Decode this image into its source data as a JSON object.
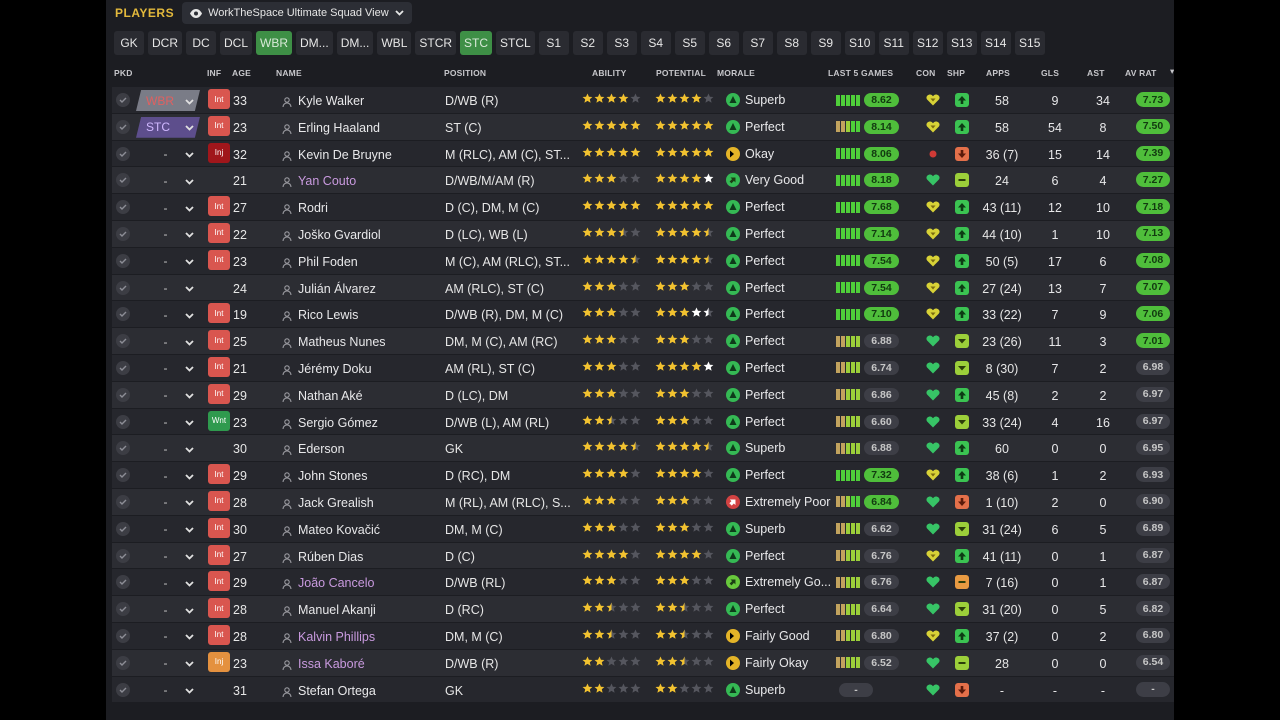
{
  "header": {
    "section_label": "PLAYERS",
    "view_name": "WorkTheSpace Ultimate Squad View"
  },
  "tabs": [
    "GK",
    "DCR",
    "DC",
    "DCL",
    "WBR",
    "DM...",
    "DM...",
    "WBL",
    "STCR",
    "STC",
    "STCL",
    "S1",
    "S2",
    "S3",
    "S4",
    "S5",
    "S6",
    "S7",
    "S8",
    "S9",
    "S10",
    "S11",
    "S12",
    "S13",
    "S14",
    "S15"
  ],
  "active_tabs": [
    "WBR",
    "STC"
  ],
  "columns": {
    "pkd": "PKD",
    "inf": "INF",
    "age": "AGE",
    "name": "NAME",
    "position": "POSITION",
    "ability": "ABILITY",
    "potential": "POTENTIAL",
    "morale": "MORALE",
    "last5": "LAST 5 GAMES",
    "con": "CON",
    "shp": "SHP",
    "apps": "APPS",
    "gls": "GLS",
    "ast": "AST",
    "avrat": "AV RAT"
  },
  "colors": {
    "accent": "#e3b93c",
    "tab_active": "#3e8f46",
    "rating_good": "#4fbe3b",
    "inf_int": "#d9564f"
  },
  "players": [
    {
      "sel": "WBR",
      "inf": "Int",
      "age": "33",
      "name": "Kyle Walker",
      "loan": false,
      "position": "D/WB (R)",
      "ability": 4,
      "potential": 4,
      "pot_hint": 0,
      "morale": "Superb",
      "mcls": "superb",
      "last5": "g5",
      "rating": "8.62",
      "con": "y",
      "shp": "up",
      "apps": "58",
      "gls": "9",
      "ast": "34",
      "avrat": "7.73",
      "good": true
    },
    {
      "sel": "STC",
      "inf": "Int",
      "age": "23",
      "name": "Erling Haaland",
      "loan": false,
      "position": "ST (C)",
      "ability": 5,
      "potential": 5,
      "pot_hint": 0,
      "morale": "Perfect",
      "mcls": "perfect",
      "last5": "m",
      "rating": "8.14",
      "con": "y",
      "shp": "up",
      "apps": "58",
      "gls": "54",
      "ast": "8",
      "avrat": "7.50",
      "good": true
    },
    {
      "sel": "-",
      "inf": "Inj",
      "age": "32",
      "name": "Kevin De Bruyne",
      "loan": false,
      "position": "M (RLC), AM (C), ST...",
      "ability": 5,
      "potential": 5,
      "pot_hint": 0,
      "morale": "Okay",
      "mcls": "okay",
      "last5": "g5",
      "rating": "8.06",
      "con": "r",
      "shp": "down",
      "apps": "36 (7)",
      "gls": "15",
      "ast": "14",
      "avrat": "7.39",
      "good": true
    },
    {
      "sel": "-",
      "inf": "",
      "age": "21",
      "name": "Yan Couto",
      "loan": true,
      "position": "D/WB/M/AM (R)",
      "ability": 3,
      "potential": 4,
      "pot_hint": 1,
      "morale": "Very Good",
      "mcls": "vgood",
      "last5": "g5",
      "rating": "8.18",
      "con": "g",
      "shp": "bar",
      "apps": "24",
      "gls": "6",
      "ast": "4",
      "avrat": "7.27",
      "good": true
    },
    {
      "sel": "-",
      "inf": "Int",
      "age": "27",
      "name": "Rodri",
      "loan": false,
      "position": "D (C), DM, M (C)",
      "ability": 5,
      "potential": 5,
      "pot_hint": 0,
      "morale": "Perfect",
      "mcls": "perfect",
      "last5": "g5",
      "rating": "7.68",
      "con": "y",
      "shp": "up",
      "apps": "43 (11)",
      "gls": "12",
      "ast": "10",
      "avrat": "7.18",
      "good": true
    },
    {
      "sel": "-",
      "inf": "Int",
      "age": "22",
      "name": "Joško Gvardiol",
      "loan": false,
      "position": "D (LC), WB (L)",
      "ability": 3.5,
      "potential": 4.5,
      "pot_hint": 0,
      "morale": "Perfect",
      "mcls": "perfect",
      "last5": "g5",
      "rating": "7.14",
      "con": "y",
      "shp": "up",
      "apps": "44 (10)",
      "gls": "1",
      "ast": "10",
      "avrat": "7.13",
      "good": true
    },
    {
      "sel": "-",
      "inf": "Int",
      "age": "23",
      "name": "Phil Foden",
      "loan": false,
      "position": "M (C), AM (RLC), ST...",
      "ability": 4.5,
      "potential": 4.5,
      "pot_hint": 0,
      "morale": "Perfect",
      "mcls": "perfect",
      "last5": "g5",
      "rating": "7.54",
      "con": "y",
      "shp": "up",
      "apps": "50 (5)",
      "gls": "17",
      "ast": "6",
      "avrat": "7.08",
      "good": true
    },
    {
      "sel": "-",
      "inf": "",
      "age": "24",
      "name": "Julián Álvarez",
      "loan": false,
      "position": "AM (RLC), ST (C)",
      "ability": 3,
      "potential": 3,
      "pot_hint": 0,
      "morale": "Perfect",
      "mcls": "perfect",
      "last5": "g5",
      "rating": "7.54",
      "con": "y",
      "shp": "up",
      "apps": "27 (24)",
      "gls": "13",
      "ast": "7",
      "avrat": "7.07",
      "good": true
    },
    {
      "sel": "-",
      "inf": "Int",
      "age": "19",
      "name": "Rico Lewis",
      "loan": false,
      "position": "D/WB (R), DM, M (C)",
      "ability": 3,
      "potential": 3,
      "pot_hint": 1.5,
      "morale": "Perfect",
      "mcls": "perfect",
      "last5": "g5",
      "rating": "7.10",
      "con": "y",
      "shp": "up",
      "apps": "33 (22)",
      "gls": "7",
      "ast": "9",
      "avrat": "7.06",
      "good": true
    },
    {
      "sel": "-",
      "inf": "Int",
      "age": "25",
      "name": "Matheus Nunes",
      "loan": false,
      "position": "DM, M (C), AM (RC)",
      "ability": 3,
      "potential": 3,
      "pot_hint": 0,
      "morale": "Perfect",
      "mcls": "perfect",
      "last5": "n",
      "rating": "6.88",
      "con": "g",
      "shp": "flat",
      "apps": "23 (26)",
      "gls": "11",
      "ast": "3",
      "avrat": "7.01",
      "good": true
    },
    {
      "sel": "-",
      "inf": "Int",
      "age": "21",
      "name": "Jérémy Doku",
      "loan": false,
      "position": "AM (RL), ST (C)",
      "ability": 3,
      "potential": 4,
      "pot_hint": 1,
      "morale": "Perfect",
      "mcls": "perfect",
      "last5": "n",
      "rating": "6.74",
      "con": "g",
      "shp": "flat",
      "apps": "8 (30)",
      "gls": "7",
      "ast": "2",
      "avrat": "6.98",
      "good": false
    },
    {
      "sel": "-",
      "inf": "Int",
      "age": "29",
      "name": "Nathan Aké",
      "loan": false,
      "position": "D (LC), DM",
      "ability": 3,
      "potential": 3,
      "pot_hint": 0,
      "morale": "Perfect",
      "mcls": "perfect",
      "last5": "n",
      "rating": "6.86",
      "con": "g",
      "shp": "up",
      "apps": "45 (8)",
      "gls": "2",
      "ast": "2",
      "avrat": "6.97",
      "good": false
    },
    {
      "sel": "-",
      "inf": "Wnt",
      "age": "23",
      "name": "Sergio Gómez",
      "loan": false,
      "position": "D/WB (L), AM (RL)",
      "ability": 2.5,
      "potential": 3,
      "pot_hint": 0,
      "morale": "Perfect",
      "mcls": "perfect",
      "last5": "n",
      "rating": "6.60",
      "con": "g",
      "shp": "flat",
      "apps": "33 (24)",
      "gls": "4",
      "ast": "16",
      "avrat": "6.97",
      "good": false
    },
    {
      "sel": "-",
      "inf": "",
      "age": "30",
      "name": "Ederson",
      "loan": false,
      "position": "GK",
      "ability": 4.5,
      "potential": 4.5,
      "pot_hint": 0,
      "morale": "Superb",
      "mcls": "superb",
      "last5": "n",
      "rating": "6.88",
      "con": "g",
      "shp": "up",
      "apps": "60",
      "gls": "0",
      "ast": "0",
      "avrat": "6.95",
      "good": false
    },
    {
      "sel": "-",
      "inf": "Int",
      "age": "29",
      "name": "John Stones",
      "loan": false,
      "position": "D (RC), DM",
      "ability": 4,
      "potential": 4,
      "pot_hint": 0,
      "morale": "Perfect",
      "mcls": "perfect",
      "last5": "g5",
      "rating": "7.32",
      "con": "y",
      "shp": "up",
      "apps": "38 (6)",
      "gls": "1",
      "ast": "2",
      "avrat": "6.93",
      "good": false
    },
    {
      "sel": "-",
      "inf": "Int",
      "age": "28",
      "name": "Jack Grealish",
      "loan": false,
      "position": "M (RL), AM (RLC), S...",
      "ability": 3,
      "potential": 3,
      "pot_hint": 0,
      "morale": "Extremely Poor",
      "mcls": "epoor",
      "last5": "m",
      "rating": "6.84",
      "con": "g",
      "shp": "down",
      "apps": "1 (10)",
      "gls": "2",
      "ast": "0",
      "avrat": "6.90",
      "good": false
    },
    {
      "sel": "-",
      "inf": "Int",
      "age": "30",
      "name": "Mateo Kovačić",
      "loan": false,
      "position": "DM, M (C)",
      "ability": 3,
      "potential": 3,
      "pot_hint": 0,
      "morale": "Superb",
      "mcls": "superb",
      "last5": "n",
      "rating": "6.62",
      "con": "g",
      "shp": "flat",
      "apps": "31 (24)",
      "gls": "6",
      "ast": "5",
      "avrat": "6.89",
      "good": false
    },
    {
      "sel": "-",
      "inf": "Int",
      "age": "27",
      "name": "Rúben Dias",
      "loan": false,
      "position": "D (C)",
      "ability": 4,
      "potential": 4,
      "pot_hint": 0,
      "morale": "Perfect",
      "mcls": "perfect",
      "last5": "n",
      "rating": "6.76",
      "con": "y",
      "shp": "up",
      "apps": "41 (11)",
      "gls": "0",
      "ast": "1",
      "avrat": "6.87",
      "good": false
    },
    {
      "sel": "-",
      "inf": "Int",
      "age": "29",
      "name": "João Cancelo",
      "loan": true,
      "position": "D/WB (RL)",
      "ability": 3,
      "potential": 3,
      "pot_hint": 0,
      "morale": "Extremely Go...",
      "mcls": "egood",
      "last5": "n",
      "rating": "6.76",
      "con": "g",
      "shp": "bar2",
      "apps": "7 (16)",
      "gls": "0",
      "ast": "1",
      "avrat": "6.87",
      "good": false
    },
    {
      "sel": "-",
      "inf": "Int",
      "age": "28",
      "name": "Manuel Akanji",
      "loan": false,
      "position": "D (RC)",
      "ability": 2.5,
      "potential": 2.5,
      "pot_hint": 0,
      "morale": "Perfect",
      "mcls": "perfect",
      "last5": "n",
      "rating": "6.64",
      "con": "g",
      "shp": "flat",
      "apps": "31 (20)",
      "gls": "0",
      "ast": "5",
      "avrat": "6.82",
      "good": false
    },
    {
      "sel": "-",
      "inf": "Int",
      "age": "28",
      "name": "Kalvin Phillips",
      "loan": true,
      "position": "DM, M (C)",
      "ability": 2.5,
      "potential": 2.5,
      "pot_hint": 0,
      "morale": "Fairly Good",
      "mcls": "fgood",
      "last5": "n",
      "rating": "6.80",
      "con": "y",
      "shp": "up",
      "apps": "37 (2)",
      "gls": "0",
      "ast": "2",
      "avrat": "6.80",
      "good": false
    },
    {
      "sel": "-",
      "inf": "Inj",
      "age": "23",
      "name": "Issa Kaboré",
      "loan": true,
      "position": "D/WB (R)",
      "ability": 2,
      "potential": 2.5,
      "pot_hint": 0,
      "morale": "Fairly Okay",
      "mcls": "fokay",
      "last5": "n",
      "rating": "6.52",
      "con": "g",
      "shp": "bar",
      "apps": "28",
      "gls": "0",
      "ast": "0",
      "avrat": "6.54",
      "good": false
    },
    {
      "sel": "-",
      "inf": "",
      "age": "31",
      "name": "Stefan Ortega",
      "loan": false,
      "position": "GK",
      "ability": 2,
      "potential": 2,
      "pot_hint": 0,
      "morale": "Superb",
      "mcls": "superb",
      "last5": "n",
      "rating": "-",
      "con": "g",
      "shp": "down",
      "apps": "-",
      "gls": "-",
      "ast": "-",
      "avrat": "-",
      "good": false
    }
  ]
}
